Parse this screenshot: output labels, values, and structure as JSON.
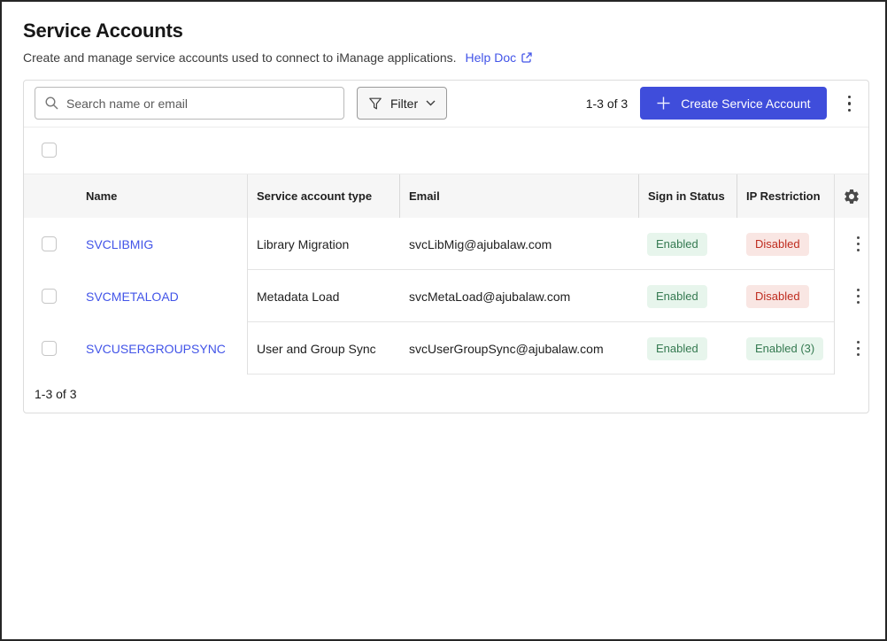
{
  "page": {
    "title": "Service Accounts",
    "subtitle": "Create and manage service accounts used to connect to iManage applications.",
    "help_link_label": "Help Doc"
  },
  "toolbar": {
    "search_placeholder": "Search name or email",
    "filter_label": "Filter",
    "range_label": "1-3 of 3",
    "create_button_label": "Create Service Account"
  },
  "table": {
    "columns": {
      "name": "Name",
      "type": "Service account type",
      "email": "Email",
      "sign_in_status": "Sign in Status",
      "ip_restriction": "IP Restriction"
    },
    "rows": [
      {
        "name": "SVCLIBMIG",
        "type": "Library Migration",
        "email": "svcLibMig@ajubalaw.com",
        "sign_in_status": "Enabled",
        "sign_in_variant": "green",
        "ip_restriction": "Disabled",
        "ip_variant": "red"
      },
      {
        "name": "SVCMETALOAD",
        "type": "Metadata Load",
        "email": "svcMetaLoad@ajubalaw.com",
        "sign_in_status": "Enabled",
        "sign_in_variant": "green",
        "ip_restriction": "Disabled",
        "ip_variant": "red"
      },
      {
        "name": "SVCUSERGROUPSYNC",
        "type": "User and Group Sync",
        "email": "svcUserGroupSync@ajubalaw.com",
        "sign_in_status": "Enabled",
        "sign_in_variant": "green",
        "ip_restriction": "Enabled (3)",
        "ip_variant": "green"
      }
    ],
    "footer_range": "1-3 of 3"
  },
  "icons": {
    "search": "magnifier",
    "filter": "funnel",
    "filter_chevron": "chevron-down",
    "create": "plus",
    "toolbar_menu": "vertical-ellipsis",
    "row_menu": "vertical-ellipsis",
    "column_settings": "gear",
    "help": "external-link"
  },
  "colors": {
    "accent_button": "#3f4ddb",
    "link": "#4254e8",
    "badge_green_bg": "#e7f5ec",
    "badge_green_text": "#357a51",
    "badge_red_bg": "#f9e6e3",
    "badge_red_text": "#bf2c1f",
    "header_bg": "#f6f6f6"
  }
}
